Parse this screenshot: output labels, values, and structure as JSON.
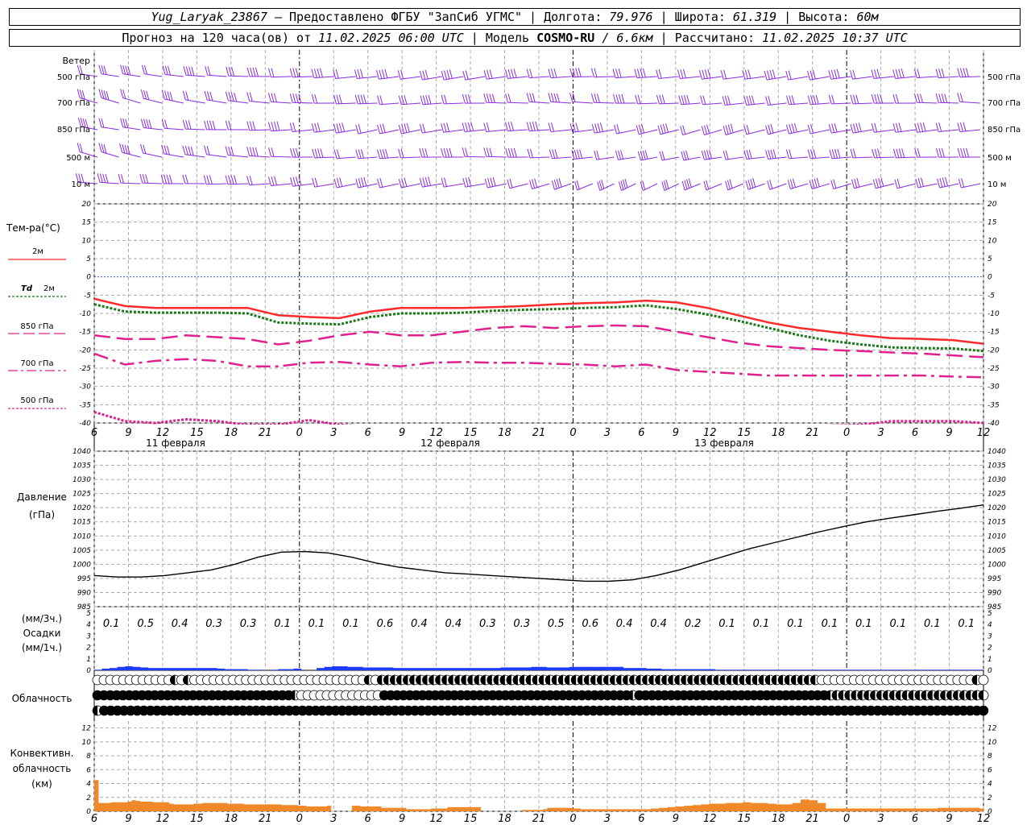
{
  "header": {
    "station": "Yug_Laryak_23867",
    "provider": "— Предоставлено ФГБУ \"ЗапСиб УГМС\"",
    "lon_label": "Долгота:",
    "lon_value": "79.976",
    "lat_label": "Широта:",
    "lat_value": "61.319",
    "alt_label": "Высота:",
    "alt_value": "60м",
    "forecast_prefix": "Прогноз на 120 часа(ов) от",
    "forecast_start": "11.02.2025 06:00 UTC",
    "model_prefix": "Модель",
    "model_name": "COSMO-RU",
    "model_res": "/ 6.6км",
    "computed_label": "Рассчитано:",
    "computed_value": "11.02.2025 10:37 UTC"
  },
  "labels": {
    "wind": "Ветер",
    "wind_levels": [
      "500 гПа",
      "700 гПа",
      "850 гПа",
      "500 м",
      "10  м"
    ],
    "temp": "Тем-ра(°C)",
    "t2m": "2м",
    "td_sym": "Td",
    "td2m": "2м",
    "t850": "850 гПа",
    "t700": "700 гПа",
    "t500": "500 гПа",
    "pressure": "Давление",
    "pressure_unit": "(гПа)",
    "precip_3h": "(мм/3ч.)",
    "precip": "Осадки",
    "precip_1h": "(мм/1ч.)",
    "cloud": "Облачность",
    "conv1": "Конвективн.",
    "conv2": "облачность",
    "conv3": "(км)"
  },
  "time_axis": {
    "hour_ticks": [
      "6",
      "9",
      "12",
      "15",
      "18",
      "21",
      "0",
      "3",
      "6",
      "9",
      "12",
      "15",
      "18",
      "21",
      "0",
      "3",
      "6",
      "9",
      "12",
      "15",
      "18",
      "21",
      "0",
      "3",
      "6",
      "9",
      "12"
    ],
    "day_labels": [
      "11 февраля",
      "12 февраля",
      "13 февраля"
    ]
  },
  "colors": {
    "wind": "#8a2be2",
    "t2m": "#ff2a2a",
    "td": "#1a7a1a",
    "t850": "#e0208f",
    "t700": "#e0208f",
    "t500": "#e0208f",
    "zero": "#3050ff",
    "pressure": "#000000",
    "precip": "#1e3cff",
    "convective": "#f0892a"
  },
  "chart_data": {
    "type": "line",
    "x_hours": [
      0,
      3,
      6,
      9,
      12,
      15,
      18,
      21,
      24,
      27,
      30,
      33,
      36,
      39,
      42,
      45,
      48,
      51,
      54,
      57,
      60,
      63,
      66,
      69,
      72,
      75,
      78
    ],
    "temperature": {
      "ylim": [
        -40,
        20
      ],
      "ticks": [
        20,
        15,
        10,
        5,
        0,
        -5,
        -10,
        -15,
        -20,
        -25,
        -30,
        -35,
        -40
      ],
      "series": [
        {
          "name": "2м",
          "values": [
            -6,
            -8,
            -8.5,
            -8.5,
            -8.5,
            -8.5,
            -10.5,
            -11,
            -11.3,
            -9.5,
            -8.5,
            -8.5,
            -8.5,
            -8.3,
            -8,
            -7.5,
            -7.2,
            -7,
            -6.5,
            -7,
            -8.5,
            -10.5,
            -12.5,
            -14,
            -15,
            -16,
            -16.8,
            -17,
            -17.3,
            -18.3
          ]
        },
        {
          "name": "Td 2м",
          "values": [
            -7.5,
            -9.5,
            -9.8,
            -9.8,
            -9.8,
            -10,
            -12.5,
            -12.8,
            -13,
            -11,
            -10,
            -10,
            -9.8,
            -9.3,
            -9,
            -8.8,
            -8.5,
            -8.3,
            -7.8,
            -8.8,
            -10.3,
            -12,
            -14,
            -16,
            -17.5,
            -18.5,
            -19.3,
            -19.5,
            -19.6,
            -20.3
          ]
        },
        {
          "name": "850 гПа",
          "values": [
            -16,
            -17,
            -17,
            -16,
            -16.5,
            -17,
            -18.5,
            -17.5,
            -16,
            -15,
            -16,
            -16,
            -15,
            -14,
            -13.5,
            -14,
            -13.5,
            -13.3,
            -13.5,
            -15,
            -16.5,
            -18,
            -19,
            -19.5,
            -20,
            -20.3,
            -20.7,
            -21,
            -21.5,
            -22
          ]
        },
        {
          "name": "700 гПа",
          "values": [
            -21,
            -24,
            -23,
            -22.5,
            -23,
            -24.5,
            -24.5,
            -23.5,
            -23.3,
            -24,
            -24.5,
            -23.5,
            -23.3,
            -23.5,
            -23.5,
            -23.8,
            -24,
            -24.5,
            -24,
            -25.5,
            -26,
            -26.5,
            -27,
            -27,
            -27,
            -27,
            -27,
            -27,
            -27.3,
            -27.5
          ]
        },
        {
          "name": "500 гПа",
          "values": [
            -37,
            -39.5,
            -40,
            -39,
            -39.5,
            -40.5,
            -40.5,
            -39.2,
            -40.5,
            -41,
            -41.5,
            -41.5,
            -41.5,
            -41.5,
            -41.5,
            -41.5,
            -41.5,
            -41.5,
            -41.5,
            -41.5,
            -41.5,
            -41.5,
            -41.5,
            -41,
            -40.7,
            -40.5,
            -39.5,
            -39.5,
            -39.5,
            -40
          ]
        }
      ],
      "series_x": [
        0,
        4,
        8,
        12,
        16,
        20,
        24,
        28,
        32,
        36,
        40,
        44,
        48,
        52,
        56,
        60,
        64,
        68,
        72,
        76,
        80,
        84,
        88,
        92,
        96,
        100,
        104,
        108,
        112,
        116
      ]
    },
    "pressure": {
      "ylim": [
        985,
        1040
      ],
      "ticks": [
        1040,
        1035,
        1030,
        1025,
        1020,
        1015,
        1010,
        1005,
        1000,
        995,
        990,
        985
      ],
      "x": [
        0,
        3,
        6,
        9,
        12,
        15,
        18,
        21,
        24,
        27,
        30,
        33,
        36,
        39,
        42,
        45,
        48,
        51,
        54,
        57,
        60,
        63,
        66,
        69,
        72,
        75,
        78,
        81,
        84,
        87,
        90,
        93,
        96,
        99,
        102,
        105,
        108,
        111,
        114
      ],
      "values": [
        996,
        995.5,
        995.5,
        996,
        997,
        998,
        1000,
        1002.5,
        1004.3,
        1004.5,
        1004,
        1002.5,
        1000.5,
        999,
        998,
        997,
        996.5,
        996,
        995.5,
        995,
        994.5,
        994,
        994,
        994.5,
        996,
        998,
        1000.5,
        1003,
        1005.5,
        1007.5,
        1009.5,
        1011.5,
        1013.3,
        1015,
        1016.3,
        1017.5,
        1018.7,
        1019.8,
        1021
      ]
    },
    "precip_3h": [
      "0.1",
      "0.5",
      "0.4",
      "0.3",
      "0.3",
      "0.1",
      "0.1",
      "0.1",
      "0.6",
      "0.4",
      "0.4",
      "0.3",
      "0.3",
      "0.5",
      "0.6",
      "0.4",
      "0.4",
      "0.2",
      "0.1",
      "0.1",
      "0.1",
      "0.1",
      "0.1",
      "0.1",
      "0.1",
      "0.1"
    ],
    "precip_1h": [
      0.05,
      0.15,
      0.2,
      0.3,
      0.35,
      0.3,
      0.25,
      0.2,
      0.2,
      0.2,
      0.2,
      0.2,
      0.2,
      0.2,
      0.2,
      0.2,
      0.15,
      0.1,
      0.1,
      0.1,
      0.05,
      0.05,
      0,
      0.05,
      0.1,
      0.1,
      0.15,
      0,
      0,
      0.2,
      0.3,
      0.35,
      0.35,
      0.3,
      0.3,
      0.25,
      0.25,
      0.25,
      0.25,
      0.2,
      0.2,
      0.2,
      0.2,
      0.2,
      0.2,
      0.2,
      0.2,
      0.2,
      0.2,
      0.2,
      0.2,
      0.2,
      0.2,
      0.25,
      0.25,
      0.25,
      0.25,
      0.3,
      0.3,
      0.25,
      0.25,
      0.25,
      0.3,
      0.3,
      0.3,
      0.3,
      0.3,
      0.3,
      0.3,
      0.2,
      0.2,
      0.2,
      0.15,
      0.15,
      0.1,
      0.1,
      0.1,
      0.1,
      0.1,
      0.1,
      0.1,
      0.05,
      0.05,
      0.05,
      0.05,
      0.05,
      0.05,
      0.05,
      0.05,
      0.05,
      0.05,
      0.05,
      0.05,
      0.05,
      0.05,
      0.05,
      0.05,
      0.05,
      0.05,
      0.05,
      0.05,
      0.05,
      0.05,
      0.05,
      0.05,
      0.05,
      0.05,
      0.05,
      0.05,
      0.05,
      0.05,
      0.05,
      0.05,
      0.05,
      0.05,
      0.05
    ],
    "precip_ylim": [
      0,
      5
    ],
    "cloud_rows": [
      "CCCCCCCCCCCCHCHCCCCCCCCCCCCCCCCCCCCCCCCCCCHCHHHHHHHHHHHHHHHHHHHHHHHHHHHHHHHHHHHHHHHHHHHHHHHHHHHHHHHHHHHHHHHHHHHHCCCCCCCCCCCCCCCCCCCCCCCCHC",
      "FFFFFFFFFFFFFFFFFFFFFFFFFFFFFFFHCCCCCCCCCCCCCFFFFFFFFFFFFFFFFFFFFFFFFFFFFFFFFFFFFFFFHFFFFFFFFFFFFFFFFFFFFFFFFFFFFFFHHHHHHHHHHHHHHHHHHHHHHHHH",
      "HFFFFFFFFFFFFFFFFFFFFFFFFFFFFFFFFFFFFFFFFFFFFFFFFFFFFFFFFFFFFFFFFFFFFFFFFFFFFFFFFFFFFFFFFFFFFFFFFFFFFFFFFFFFFFFFFFFFFFFFFFFFFFFFFFFFFFF"
    ],
    "convective_km": [
      4.5,
      1.2,
      1.2,
      1.2,
      1.3,
      1.3,
      1.3,
      1.3,
      1.4,
      1.6,
      1.5,
      1.4,
      1.4,
      1.4,
      1.3,
      1.3,
      1.3,
      1.3,
      1.1,
      1.0,
      1.0,
      1.0,
      1.0,
      1.0,
      1.1,
      1.1,
      1.2,
      1.2,
      1.2,
      1.2,
      1.2,
      1.2,
      1.1,
      1.1,
      1.1,
      1.1,
      1.0,
      1.0,
      1.0,
      1.0,
      1.0,
      1.0,
      1.0,
      1.0,
      1.0,
      0.9,
      0.9,
      0.9,
      0.9,
      0.8,
      0.8,
      0.7,
      0.7,
      0.7,
      0.7,
      0.7,
      0.8,
      0,
      0,
      0,
      0,
      0,
      0.8,
      0.8,
      0.7,
      0.7,
      0.7,
      0.7,
      0.7,
      0.5,
      0.5,
      0.5,
      0.5,
      0.5,
      0.5,
      0.3,
      0.3,
      0.3,
      0.3,
      0.3,
      0.3,
      0.4,
      0.4,
      0.4,
      0.4,
      0.6,
      0.6,
      0.6,
      0.6,
      0.6,
      0.6,
      0.6,
      0.6,
      0,
      0,
      0,
      0,
      0,
      0,
      0,
      0,
      0,
      0,
      0.2,
      0.2,
      0.2,
      0.2,
      0.2,
      0.3,
      0.5,
      0.5,
      0.5,
      0.5,
      0.5,
      0.5,
      0.4,
      0.4,
      0.3,
      0.3,
      0.3,
      0.3,
      0.3,
      0.3,
      0.3,
      0.3,
      0.3,
      0.3,
      0.3,
      0.3,
      0.3,
      0.3,
      0.3,
      0.3,
      0.3,
      0.4,
      0.4,
      0.5,
      0.5,
      0.6,
      0.6,
      0.7,
      0.7,
      0.8,
      0.8,
      0.9,
      0.9,
      1.0,
      1.0,
      1.1,
      1.1,
      1.1,
      1.1,
      1.2,
      1.2,
      1.2,
      1.2,
      1.3,
      1.3,
      1.2,
      1.2,
      1.2,
      1.2,
      1.1,
      1.1,
      1.0,
      1.0,
      1.0,
      1.0,
      1.2,
      1.2,
      1.7,
      1.7,
      1.6,
      1.6,
      1.2,
      1.2,
      0.4,
      0.4,
      0.4,
      0.4,
      0.4,
      0.4,
      0.4,
      0.4,
      0.4,
      0.4,
      0.4,
      0.4,
      0.4,
      0.4,
      0.4,
      0.4,
      0.4,
      0.4,
      0.4,
      0.4,
      0.4,
      0.4,
      0.4,
      0.4,
      0.4,
      0.4,
      0.4,
      0.5,
      0.5,
      0.5,
      0.5,
      0.5,
      0.5,
      0.5,
      0.5,
      0.5,
      0.5,
      0.4
    ],
    "convective_ylim": [
      0,
      13
    ],
    "convective_ticks": [
      0,
      2,
      4,
      6,
      8,
      10,
      12
    ]
  }
}
